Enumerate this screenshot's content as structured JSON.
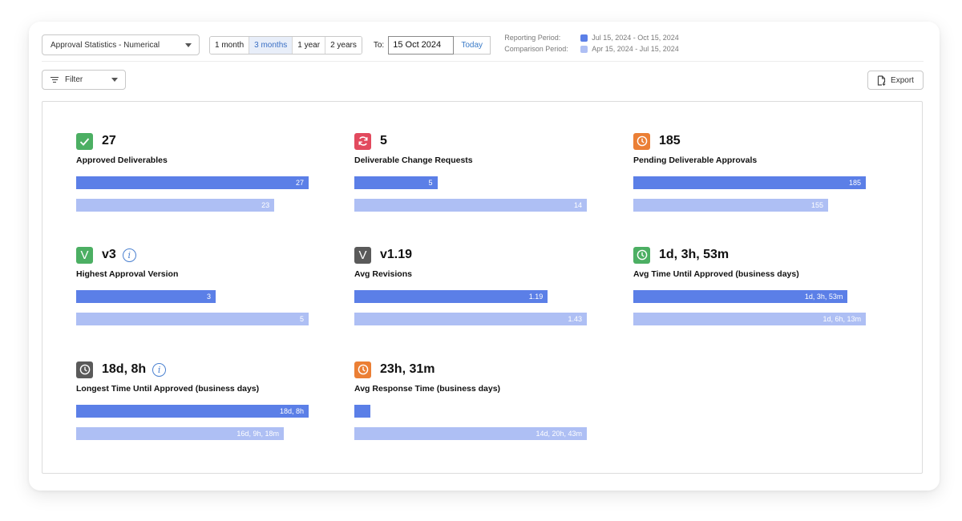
{
  "toolbar": {
    "report_select": "Approval Statistics - Numerical",
    "ranges": [
      {
        "label": "1 month",
        "active": false
      },
      {
        "label": "3 months",
        "active": true
      },
      {
        "label": "1 year",
        "active": false
      },
      {
        "label": "2 years",
        "active": false
      }
    ],
    "to_label": "To:",
    "to_date": "15 Oct 2024",
    "today_label": "Today",
    "reporting_period_label": "Reporting Period:",
    "reporting_period_value": "Jul 15, 2024 - Oct 15, 2024",
    "comparison_period_label": "Comparison Period:",
    "comparison_period_value": "Apr 15, 2024 - Jul 15, 2024",
    "filter_label": "Filter",
    "export_label": "Export"
  },
  "colors": {
    "reporting": "#5b7fe7",
    "comparison": "#aebff4",
    "green": "#4caf63",
    "red": "#e24a5e",
    "orange": "#eb7f35",
    "gray": "#5a5a5a"
  },
  "metrics": [
    {
      "value": "27",
      "label": "Approved Deliverables",
      "icon": "check-icon",
      "icon_color": "green",
      "info": false,
      "current": {
        "text": "27",
        "fraction": 1.0
      },
      "comparison": {
        "text": "23",
        "fraction": 0.852
      }
    },
    {
      "value": "5",
      "label": "Deliverable Change Requests",
      "icon": "refresh-icon",
      "icon_color": "red",
      "info": false,
      "current": {
        "text": "5",
        "fraction": 0.357
      },
      "comparison": {
        "text": "14",
        "fraction": 1.0
      }
    },
    {
      "value": "185",
      "label": "Pending Deliverable Approvals",
      "icon": "clock-icon",
      "icon_color": "orange",
      "info": false,
      "current": {
        "text": "185",
        "fraction": 1.0
      },
      "comparison": {
        "text": "155",
        "fraction": 0.838
      }
    },
    {
      "value": "v3",
      "label": "Highest Approval Version",
      "icon": "version-icon",
      "icon_color": "green",
      "info": true,
      "current": {
        "text": "3",
        "fraction": 0.6
      },
      "comparison": {
        "text": "5",
        "fraction": 1.0
      }
    },
    {
      "value": "v1.19",
      "label": "Avg Revisions",
      "icon": "version-icon",
      "icon_color": "gray",
      "info": false,
      "current": {
        "text": "1.19",
        "fraction": 0.832
      },
      "comparison": {
        "text": "1.43",
        "fraction": 1.0
      }
    },
    {
      "value": "1d, 3h, 53m",
      "label": "Avg Time Until Approved (business days)",
      "icon": "clock-icon",
      "icon_color": "green",
      "info": false,
      "current": {
        "text": "1d, 3h, 53m",
        "fraction": 0.922
      },
      "comparison": {
        "text": "1d, 6h, 13m",
        "fraction": 1.0
      }
    },
    {
      "value": "18d, 8h",
      "label": "Longest Time Until Approved (business days)",
      "icon": "clock-icon",
      "icon_color": "gray",
      "info": true,
      "current": {
        "text": "18d, 8h",
        "fraction": 1.0
      },
      "comparison": {
        "text": "16d, 9h, 18m",
        "fraction": 0.893
      }
    },
    {
      "value": "23h, 31m",
      "label": "Avg Response Time (business days)",
      "icon": "clock-icon",
      "icon_color": "orange",
      "info": false,
      "current": {
        "text": "",
        "fraction": 0.066
      },
      "comparison": {
        "text": "14d, 20h, 43m",
        "fraction": 1.0
      }
    }
  ]
}
